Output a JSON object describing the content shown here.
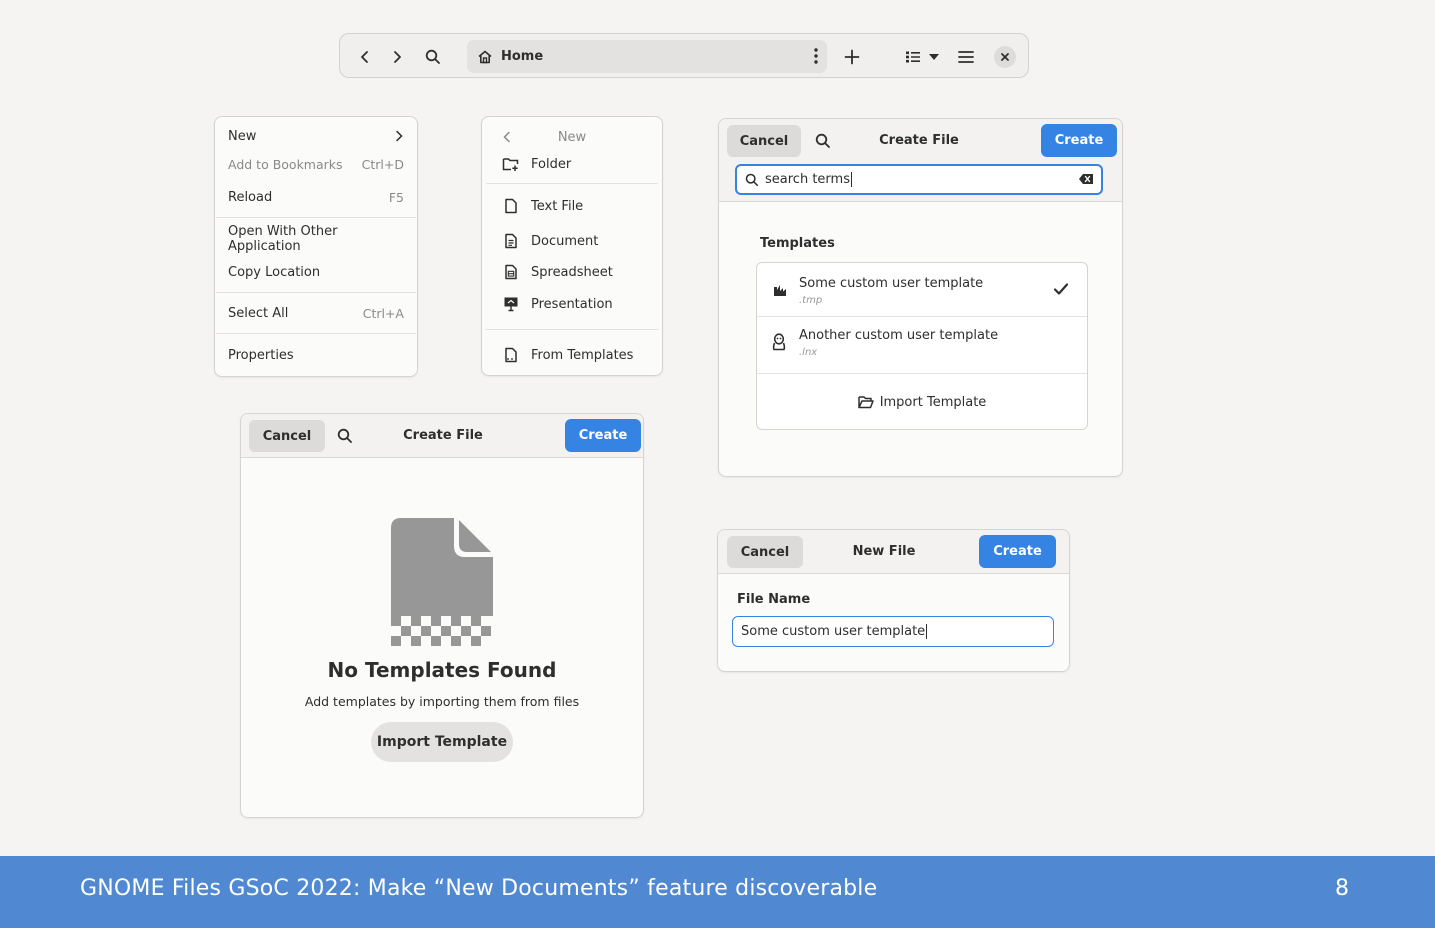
{
  "toolbar": {
    "path_label": "Home",
    "icons": [
      "back-icon",
      "forward-icon",
      "search-icon",
      "home-icon",
      "more-icon",
      "new-icon",
      "list-view-icon",
      "dropdown-icon",
      "menu-icon",
      "close-icon"
    ]
  },
  "context_menu": {
    "items": [
      {
        "label": "New",
        "accel": ""
      },
      {
        "label": "Add to Bookmarks",
        "accel": "Ctrl+D"
      },
      {
        "label": "Reload",
        "accel": "F5"
      },
      {
        "label": "Open With Other Application",
        "accel": ""
      },
      {
        "label": "Copy Location",
        "accel": ""
      },
      {
        "label": "Select All",
        "accel": "Ctrl+A"
      },
      {
        "label": "Properties",
        "accel": ""
      }
    ]
  },
  "new_submenu": {
    "title": "New",
    "items": [
      {
        "label": "Folder",
        "icon": "new-folder-icon"
      },
      {
        "label": "Text File",
        "icon": "file-icon"
      },
      {
        "label": "Document",
        "icon": "document-icon"
      },
      {
        "label": "Spreadsheet",
        "icon": "spreadsheet-icon"
      },
      {
        "label": "Presentation",
        "icon": "presentation-icon"
      },
      {
        "label": "From Templates",
        "icon": "template-icon"
      }
    ]
  },
  "create_dialog_templates": {
    "cancel_label": "Cancel",
    "title": "Create File",
    "create_label": "Create",
    "search_value": "search terms",
    "section_title": "Templates",
    "templates": [
      {
        "name": "Some custom user template",
        "ext": ".tmp",
        "selected": true
      },
      {
        "name": "Another custom user template",
        "ext": ".lnx",
        "selected": false
      }
    ],
    "import_label": "Import Template"
  },
  "create_dialog_empty": {
    "cancel_label": "Cancel",
    "title": "Create File",
    "create_label": "Create",
    "empty_title": "No Templates Found",
    "empty_subtitle": "Add templates by importing them from files",
    "import_label": "Import Template"
  },
  "new_file_dialog": {
    "cancel_label": "Cancel",
    "title": "New File",
    "create_label": "Create",
    "field_label": "File Name",
    "field_value": "Some custom user template"
  },
  "footer": {
    "title": "GNOME Files GSoC 2022:  Make “New Documents” feature discoverable",
    "page": "8"
  },
  "colors": {
    "accent": "#3584e4",
    "footer_bg": "#5089d1",
    "background": "#f5f4f2"
  }
}
